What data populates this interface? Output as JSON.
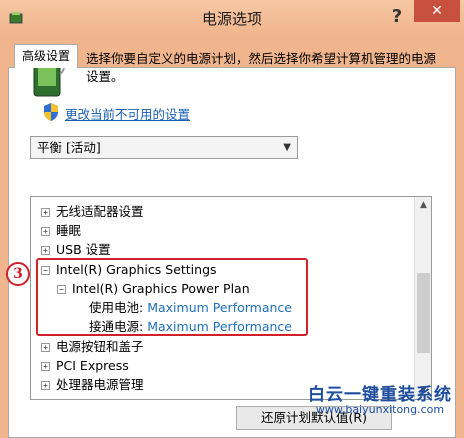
{
  "window": {
    "title": "电源选项",
    "help_label": "?",
    "close_label": "✕"
  },
  "tab": {
    "label": "高级设置"
  },
  "description": "选择你要自定义的电源计划，然后选择你希望计算机管理的电源设置。",
  "change_link": "更改当前不可用的设置",
  "plan_select": {
    "value": "平衡 [活动]"
  },
  "tree": {
    "items": [
      {
        "expander": "+",
        "label": "无线适配器设置"
      },
      {
        "expander": "+",
        "label": "睡眠"
      },
      {
        "expander": "+",
        "label": "USB 设置"
      },
      {
        "expander": "−",
        "label": "Intel(R) Graphics Settings"
      },
      {
        "expander": "−",
        "label": "Intel(R) Graphics Power Plan"
      },
      {
        "label": "使用电池:",
        "value": "Maximum Performance"
      },
      {
        "label": "接通电源:",
        "value": "Maximum Performance"
      },
      {
        "expander": "+",
        "label": "电源按钮和盖子"
      },
      {
        "expander": "+",
        "label": "PCI Express"
      },
      {
        "expander": "+",
        "label": "处理器电源管理"
      }
    ]
  },
  "annotation": {
    "step": "3"
  },
  "restore_button": "还原计划默认值(R)",
  "watermark": {
    "title": "白云一键重装系统",
    "url": "www.baiyunxitong.com"
  },
  "colors": {
    "titlebar": "#f6c7a3",
    "close_button": "#c7503e",
    "link": "#1a5fb4",
    "highlight": "#d0202a",
    "watermark": "#1d4d9e"
  }
}
